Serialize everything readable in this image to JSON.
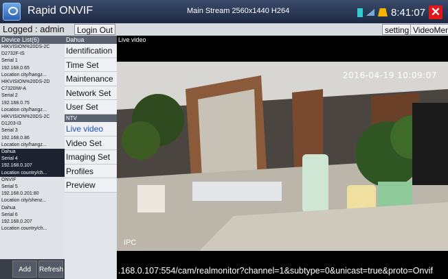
{
  "titlebar": {
    "app_title": "Rapid ONVIF",
    "stream_info": "Main Stream 2560x1440 H264",
    "clock": "8:41:07",
    "close_glyph": "✕"
  },
  "toolbar": {
    "logged_text": "Logged : admin",
    "login_out": "Login Out",
    "setting": "setting",
    "video_menu": "VideoMenu"
  },
  "device_list": {
    "header": "Device List(6)",
    "devices": [
      {
        "model": "HIKVISION%20DS-2C",
        "model2": "D2732F-IS",
        "serial": "Serial 1",
        "ip": "192.168.0.65",
        "location": "Location city/hangz..."
      },
      {
        "model": "HIKVISION%20DS-2D",
        "model2": "C7320IW-A",
        "serial": "Serial 2",
        "ip": "192.168.0.75",
        "location": "Location city/hangz..."
      },
      {
        "model": "HIKVISION%20DS-2C",
        "model2": "D1203-I3",
        "serial": "Serial 3",
        "ip": "192.168.0.86",
        "location": "Location city/hangz..."
      },
      {
        "model": "Dahua",
        "serial": "Serial 4",
        "ip": "192.168.0.107",
        "location": "Location country/ch..."
      },
      {
        "model": "ONVIF",
        "serial": "Serial 5",
        "ip": "192.168.0.201:80",
        "location": "Location city/shenz..."
      },
      {
        "model": "Dahua",
        "serial": "Serial 6",
        "ip": "192.168.0.207",
        "location": "Location country/ch..."
      }
    ],
    "add": "Add",
    "refresh": "Refresh"
  },
  "menu": {
    "header": "Dahua",
    "items_top": [
      "Identification",
      "Time Set",
      "Maintenance",
      "Network Set",
      "User Set"
    ],
    "sub_header": "NTV",
    "items_bottom": [
      "Live video",
      "Video Set",
      "Imaging Set",
      "Profiles",
      "Preview"
    ]
  },
  "video": {
    "label": "Live video",
    "timestamp": "2016-04-19 10:09:07",
    "overlay": "IPC",
    "url": ".168.0.107:554/cam/realmonitor?channel=1&subtype=0&unicast=true&proto=Onvif"
  }
}
